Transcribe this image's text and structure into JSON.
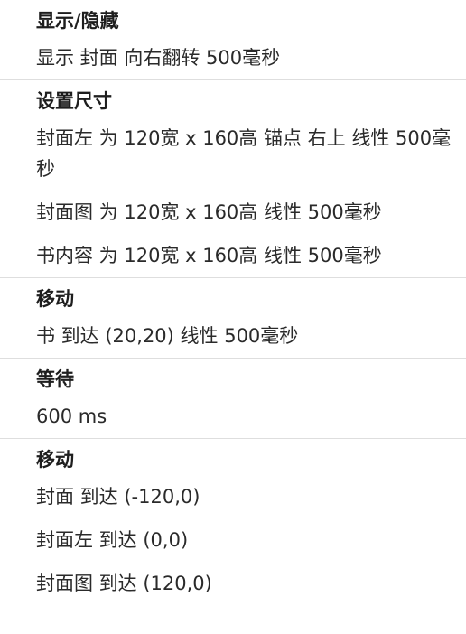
{
  "sections": [
    {
      "header": "显示/隐藏",
      "items": [
        "显示 封面 向右翻转 500毫秒"
      ]
    },
    {
      "header": "设置尺寸",
      "items": [
        "封面左 为 120宽 x 160高  锚点 右上 线性 500毫秒",
        "封面图 为 120宽 x 160高 线性 500毫秒",
        "书内容 为 120宽 x 160高 线性 500毫秒"
      ]
    },
    {
      "header": "移动",
      "items": [
        "书 到达 (20,20) 线性 500毫秒"
      ]
    },
    {
      "header": "等待",
      "items": [
        "600 ms"
      ]
    },
    {
      "header": "移动",
      "items": [
        "封面 到达 (-120,0)",
        "封面左 到达 (0,0)",
        "封面图 到达 (120,0)"
      ]
    }
  ]
}
